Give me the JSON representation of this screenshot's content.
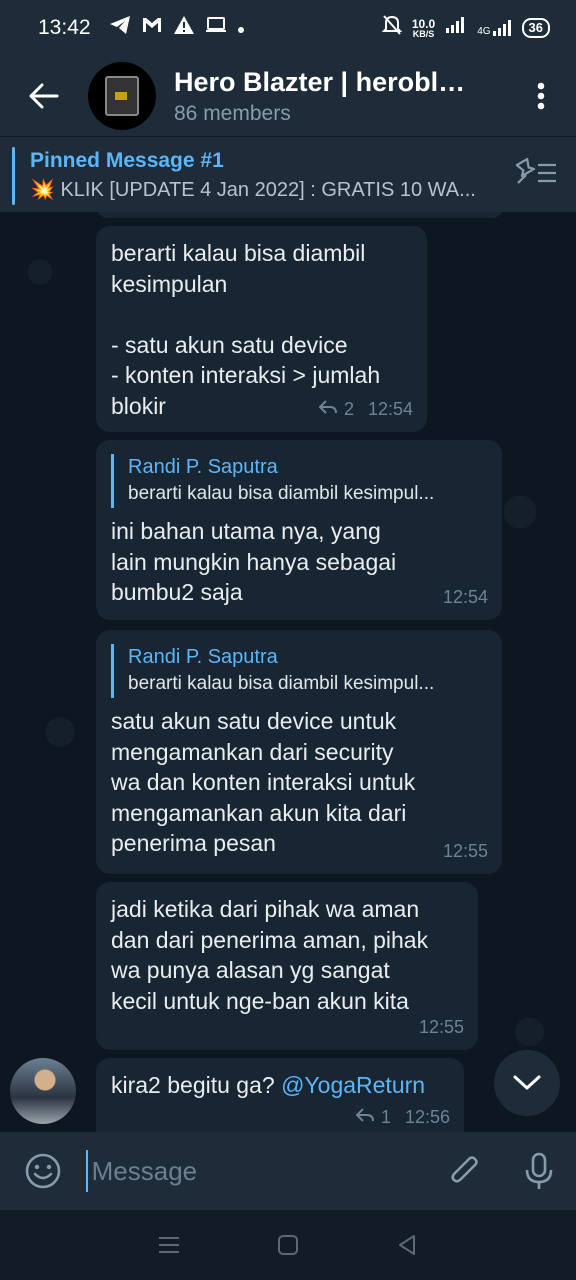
{
  "status_bar": {
    "time": "13:42",
    "net_speed_value": "10.0",
    "net_speed_unit": "KB/S",
    "battery": "36",
    "network_label": "4G"
  },
  "header": {
    "title": "Hero Blazter | herobla...",
    "subtitle": "86 members"
  },
  "pinned": {
    "title": "Pinned Message #1",
    "text": "💥 KLIK [UPDATE 4 Jan 2022] : GRATIS 10 WA..."
  },
  "messages": [
    {
      "text": "berarti kalau bisa diambil\nkesimpulan\n\n- satu akun satu device\n- konten interaksi > jumlah\nblokir",
      "replies": "2",
      "time": "12:54"
    },
    {
      "reply_name": "Randi P. Saputra",
      "reply_text": "berarti kalau bisa diambil kesimpul...",
      "text": "ini bahan utama nya, yang\nlain mungkin hanya sebagai\nbumbu2 saja",
      "time": "12:54"
    },
    {
      "reply_name": "Randi P. Saputra",
      "reply_text": "berarti kalau bisa diambil kesimpul...",
      "text": "satu akun satu device untuk\nmengamankan dari security\nwa dan konten interaksi untuk\nmengamankan akun kita dari\npenerima pesan",
      "time": "12:55"
    },
    {
      "text": "jadi ketika dari pihak wa aman\ndan dari penerima aman, pihak\nwa punya alasan yg sangat\nkecil untuk nge-ban akun kita",
      "time": "12:55"
    },
    {
      "text": "kira2 begitu ga? ",
      "mention": "@YogaReturn",
      "replies": "1",
      "time": "12:56"
    }
  ],
  "input": {
    "placeholder": "Message"
  },
  "colors": {
    "accent": "#5eb5f7",
    "background": "#0e1621",
    "bubble": "#182533",
    "header": "#1e2c3a"
  }
}
